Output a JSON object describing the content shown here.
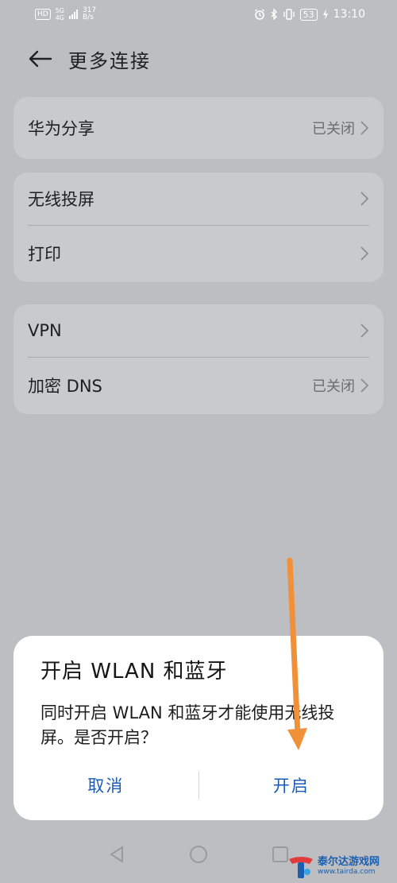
{
  "status_bar": {
    "hd": "HD",
    "net_type_top": "5G",
    "net_type_bottom": "4G",
    "speed_value": "317",
    "speed_unit": "B/s",
    "battery": "53",
    "time": "13:10"
  },
  "header": {
    "title": "更多连接"
  },
  "cards": [
    {
      "rows": [
        {
          "label": "华为分享",
          "value": "已关闭"
        }
      ]
    },
    {
      "rows": [
        {
          "label": "无线投屏",
          "value": ""
        },
        {
          "label": "打印",
          "value": ""
        }
      ]
    },
    {
      "rows": [
        {
          "label": "VPN",
          "value": ""
        },
        {
          "label": "加密 DNS",
          "value": "已关闭"
        }
      ]
    }
  ],
  "dialog": {
    "title": "开启 WLAN 和蓝牙",
    "message": "同时开启 WLAN 和蓝牙才能使用无线投屏。是否开启？",
    "cancel": "取消",
    "confirm": "开启"
  },
  "watermark": {
    "cn": "泰尔达游戏网",
    "url": "www.tairda.com"
  },
  "colors": {
    "accent": "#1a5bb6",
    "annotation_arrow": "#f0913a",
    "background": "#bdbec1"
  }
}
